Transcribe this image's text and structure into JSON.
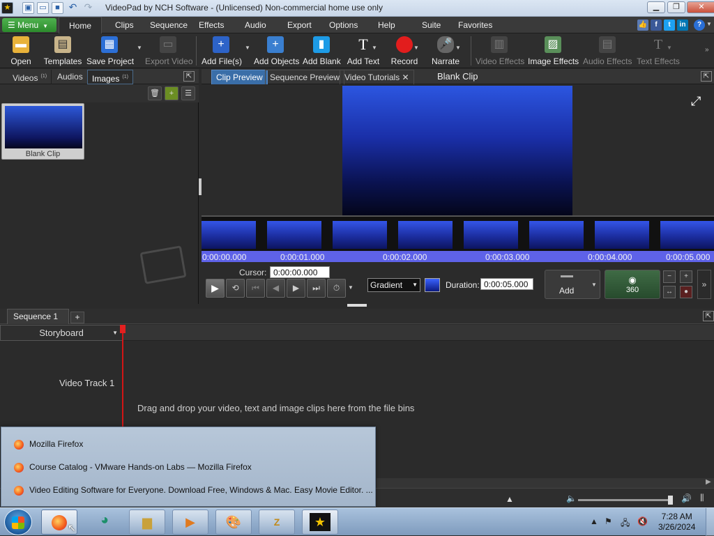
{
  "window": {
    "title": "VideoPad by NCH Software - (Unlicensed) Non-commercial home use only"
  },
  "menubar": {
    "menu_label": "Menu",
    "tabs": [
      "Home",
      "Clips",
      "Sequence",
      "Effects",
      "Audio",
      "Export",
      "Options",
      "Help",
      "Suite",
      "Favorites"
    ]
  },
  "toolbar": {
    "open": "Open",
    "templates": "Templates",
    "save_project": "Save Project",
    "export_video": "Export Video",
    "add_files": "Add File(s)",
    "add_objects": "Add Objects",
    "add_blank": "Add Blank",
    "add_text": "Add Text",
    "record": "Record",
    "narrate": "Narrate",
    "video_effects": "Video Effects",
    "image_effects": "Image Effects",
    "audio_effects": "Audio Effects",
    "text_effects": "Text Effects"
  },
  "bins": {
    "tabs": [
      {
        "label": "Videos",
        "count": "(1)"
      },
      {
        "label": "Audios",
        "count": ""
      },
      {
        "label": "Images",
        "count": "(1)"
      }
    ],
    "clip_caption": "Blank Clip"
  },
  "preview": {
    "tabs": [
      "Clip Preview",
      "Sequence Preview",
      "Video Tutorials"
    ],
    "title": "Blank Clip",
    "ruler": [
      "0:00:00.000",
      "0:00:01.000",
      "0:00:02.000",
      "0:00:03.000",
      "0:00:04.000",
      "0:00:05.000"
    ],
    "cursor_label": "Cursor:",
    "cursor_value": "0:00:00.000",
    "fill_type": "Gradient",
    "duration_label": "Duration:",
    "duration_value": "0:00:05.000",
    "add_label": "Add",
    "btn_360": "360"
  },
  "sequence": {
    "tab": "Sequence 1",
    "add_tab": "+",
    "view_mode": "Storyboard",
    "track_label": "Video Track 1",
    "drop_hint": "Drag and drop your video, text and image clips here from the file bins"
  },
  "jumplist": {
    "items": [
      "Mozilla Firefox",
      "Course Catalog - VMware Hands-on Labs — Mozilla Firefox",
      "Video Editing Software for Everyone. Download Free, Windows & Mac. Easy Movie Editor. ..."
    ]
  },
  "taskbar": {
    "time": "7:28 AM",
    "date": "3/26/2024"
  },
  "colors": {
    "accent_green": "#2c8a2c",
    "clip_blue": "#2c56e0",
    "ruler_blue": "#5e62e8",
    "playhead_red": "#d31515"
  }
}
